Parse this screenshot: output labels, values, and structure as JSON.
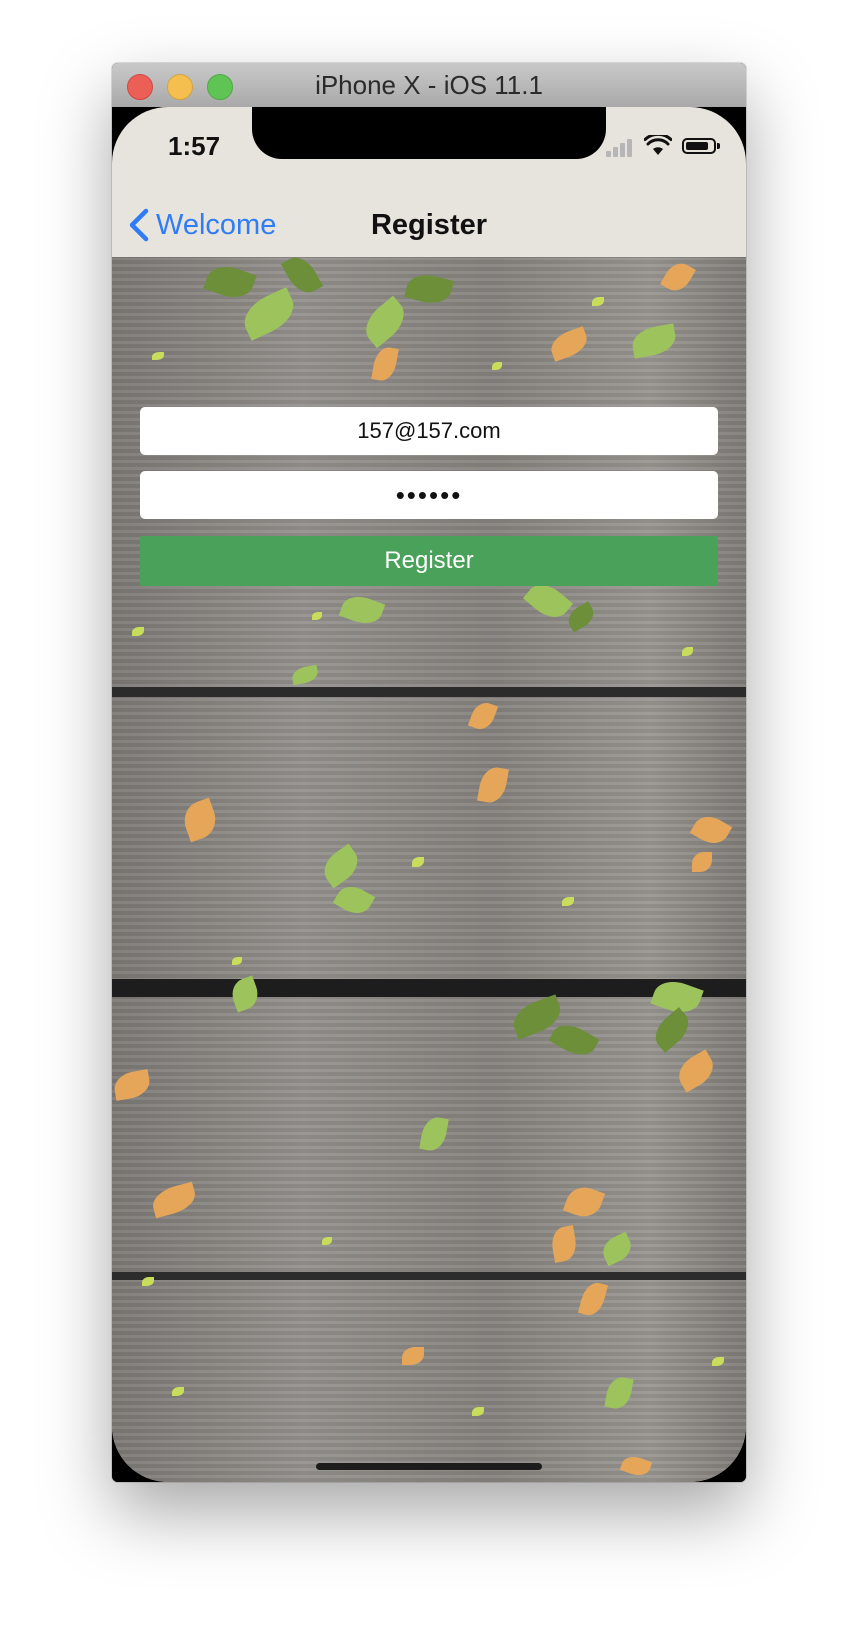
{
  "simulator": {
    "title": "iPhone X - iOS 11.1"
  },
  "status_bar": {
    "time": "1:57"
  },
  "nav_bar": {
    "back_label": "Welcome",
    "title": "Register"
  },
  "form": {
    "email_value": "157@157.com",
    "password_value": "••••••",
    "register_label": "Register"
  },
  "colors": {
    "accent_blue": "#2f7cf6",
    "register_green": "#4aa15a"
  },
  "icons": {
    "back": "chevron-left-icon",
    "signal": "cellular-signal-icon",
    "wifi": "wifi-icon",
    "battery": "battery-icon"
  }
}
